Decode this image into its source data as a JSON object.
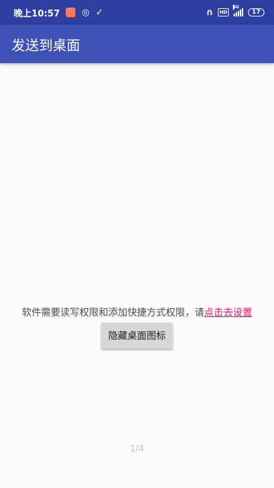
{
  "status_bar": {
    "time": "晚上10:57",
    "network_label": "4G",
    "hd_label": "HD",
    "battery_level": "17"
  },
  "app_bar": {
    "title": "发送到桌面"
  },
  "main": {
    "permission_message": "软件需要读写权限和添加快捷方式权限，请",
    "settings_link": "点击去设置",
    "hide_icon_button": "隐藏桌面图标",
    "page_indicator": "1/4"
  },
  "colors": {
    "status_bar": "#2f3fa0",
    "app_bar": "#3f51b5",
    "link": "#e91e63",
    "background": "#fdfafd"
  }
}
